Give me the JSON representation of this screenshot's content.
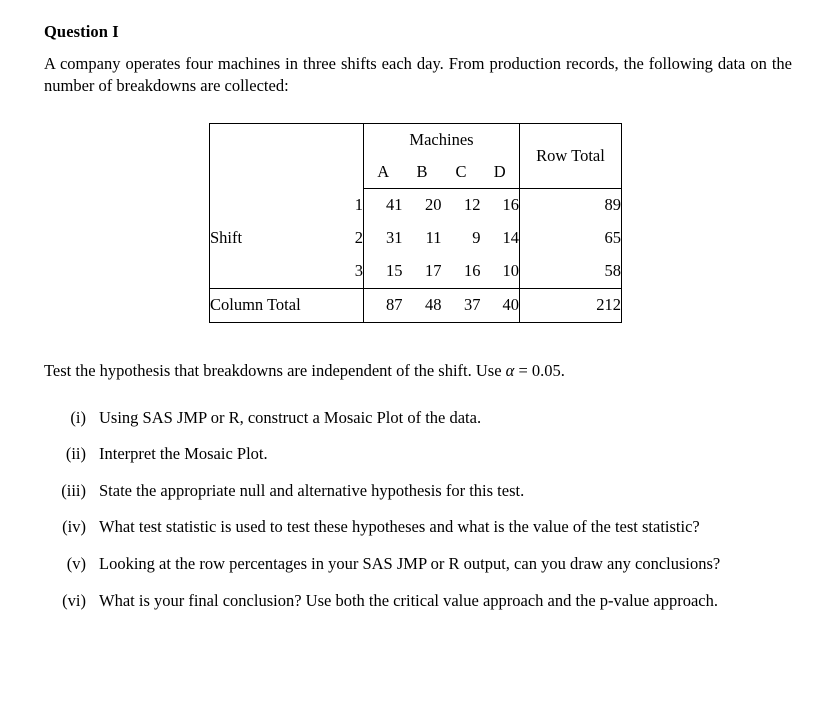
{
  "document": {
    "title": "Question I",
    "intro": "A company operates four machines in three shifts each day.  From production records, the following data on the number of breakdowns are collected:",
    "hypothesis_prefix": "Test the hypothesis that breakdowns are independent of the shift. Use ",
    "hypothesis_symbol": "α",
    "hypothesis_suffix": " = 0.05."
  },
  "table": {
    "group_header": "Machines",
    "machine_columns": [
      "A",
      "B",
      "C",
      "D"
    ],
    "row_total_header": "Row Total",
    "row_group_label": "Shift",
    "column_total_label": "Column Total",
    "rows": [
      {
        "level": "1",
        "values": [
          "41",
          "20",
          "12",
          "16"
        ],
        "row_total": "89"
      },
      {
        "level": "2",
        "values": [
          "31",
          "11",
          "9",
          "14"
        ],
        "row_total": "65"
      },
      {
        "level": "3",
        "values": [
          "15",
          "17",
          "16",
          "10"
        ],
        "row_total": "58"
      }
    ],
    "column_totals": [
      "87",
      "48",
      "37",
      "40"
    ],
    "grand_total": "212"
  },
  "questions": [
    {
      "marker": "(i)",
      "text": "Using SAS JMP or R, construct a Mosaic Plot of the data."
    },
    {
      "marker": "(ii)",
      "text": "Interpret the Mosaic Plot."
    },
    {
      "marker": "(iii)",
      "text": "State the appropriate null and alternative hypothesis for this test."
    },
    {
      "marker": "(iv)",
      "text": "What test statistic is used to test these hypotheses and what is the value of the test statistic?"
    },
    {
      "marker": "(v)",
      "text": "Looking at the row percentages in your SAS JMP or R output, can you draw any conclusions?"
    },
    {
      "marker": "(vi)",
      "text": "What is your final conclusion?  Use both the critical value approach and the p-value approach."
    }
  ]
}
